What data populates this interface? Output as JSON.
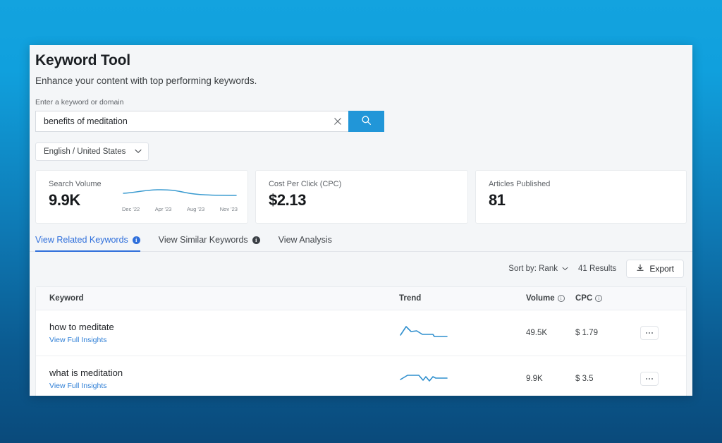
{
  "app": {
    "title": "Keyword Tool",
    "subtitle": "Enhance your content with top performing keywords."
  },
  "search": {
    "label": "Enter a keyword or domain",
    "value": "benefits of meditation",
    "placeholder": "Enter a keyword or domain",
    "clear_icon": "close-icon",
    "submit_icon": "search-icon",
    "accent_color": "#2196d8"
  },
  "locale": {
    "selected": "English / United States",
    "chevron_icon": "chevron-down-icon"
  },
  "cards": {
    "volume": {
      "label": "Search Volume",
      "value": "9.9K",
      "axis": [
        "Dec '22",
        "Apr '23",
        "Aug '23",
        "Nov '23"
      ]
    },
    "cpc": {
      "label": "Cost Per Click (CPC)",
      "value": "$2.13"
    },
    "articles": {
      "label": "Articles Published",
      "value": "81"
    }
  },
  "tabs": [
    {
      "label": "View Related Keywords",
      "info": true,
      "active": true
    },
    {
      "label": "View Similar Keywords",
      "info": true,
      "active": false
    },
    {
      "label": "View Analysis",
      "info": false,
      "active": false
    }
  ],
  "toolbar": {
    "sort_label": "Sort by: Rank",
    "sort_chevron_icon": "chevron-down-icon",
    "results_label": "41 Results",
    "export_label": "Export",
    "export_icon": "download-icon"
  },
  "table": {
    "headers": {
      "keyword": "Keyword",
      "trend": "Trend",
      "volume": "Volume",
      "cpc": "CPC"
    },
    "rows": [
      {
        "keyword": "how to meditate",
        "link": "View Full Insights",
        "volume": "49.5K",
        "cpc": "$ 1.79",
        "more_icon": "ellipsis-icon"
      },
      {
        "keyword": "what is meditation",
        "link": "View Full Insights",
        "volume": "9.9K",
        "cpc": "$ 3.5",
        "more_icon": "ellipsis-icon"
      }
    ]
  },
  "chart_data": [
    {
      "type": "line",
      "title": "Search Volume",
      "name": "search-volume-sparkline",
      "x": [
        "Dec '22",
        "Jan '23",
        "Feb '23",
        "Mar '23",
        "Apr '23",
        "May '23",
        "Jun '23",
        "Jul '23",
        "Aug '23",
        "Sep '23",
        "Oct '23",
        "Nov '23"
      ],
      "values": [
        9.6,
        9.9,
        10.1,
        10.2,
        10.2,
        10.1,
        9.9,
        9.8,
        9.8,
        9.8,
        9.9,
        9.9
      ],
      "ylabel": "Search Volume",
      "xlabel": "",
      "grid": false,
      "legend": "none",
      "color": "#3a9bd0"
    },
    {
      "type": "line",
      "title": "how to meditate trend",
      "name": "row-trend-how-to-meditate",
      "x": [
        1,
        2,
        3,
        4,
        5,
        6,
        7,
        8
      ],
      "values": [
        30,
        78,
        55,
        58,
        40,
        40,
        40,
        28
      ],
      "grid": false,
      "legend": "none",
      "color": "#2f8fce"
    },
    {
      "type": "line",
      "title": "what is meditation trend",
      "name": "row-trend-what-is-meditation",
      "x": [
        1,
        2,
        3,
        4,
        5,
        6,
        7,
        8
      ],
      "values": [
        40,
        62,
        65,
        62,
        30,
        52,
        28,
        48
      ],
      "grid": false,
      "legend": "none",
      "color": "#2f8fce"
    }
  ]
}
